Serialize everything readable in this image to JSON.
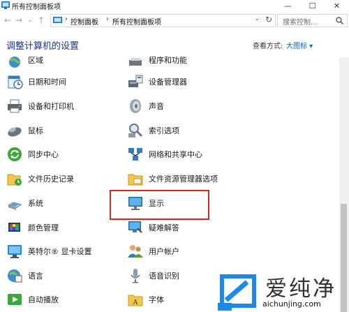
{
  "window": {
    "title": "所有控制面板项",
    "controls": {
      "minimize": "—",
      "maximize": "☐",
      "close": "✕"
    }
  },
  "navbar": {
    "back": "←",
    "forward": "→",
    "history": "⌄",
    "up": "↑",
    "breadcrumb": [
      "控制面板",
      "所有控制面板项"
    ],
    "separator": "›",
    "dropdown": "⌄",
    "refresh": "↻",
    "search_placeholder": "搜索控制..."
  },
  "header": {
    "heading": "调整计算机的设置",
    "view_by_label": "查看方式:",
    "view_by_value": "大图标 ▾"
  },
  "items_left": [
    {
      "id": "region",
      "label": "区域",
      "icon": "region-icon"
    },
    {
      "id": "datetime",
      "label": "日期和时间",
      "icon": "datetime-icon"
    },
    {
      "id": "devices-printers",
      "label": "设备和打印机",
      "icon": "printer-icon"
    },
    {
      "id": "mouse",
      "label": "鼠标",
      "icon": "mouse-icon"
    },
    {
      "id": "sync-center",
      "label": "同步中心",
      "icon": "sync-icon"
    },
    {
      "id": "file-history",
      "label": "文件历史记录",
      "icon": "file-history-icon"
    },
    {
      "id": "system",
      "label": "系统",
      "icon": "system-icon"
    },
    {
      "id": "color-management",
      "label": "颜色管理",
      "icon": "color-management-icon"
    },
    {
      "id": "intel-graphics",
      "label": "英特尔® 显卡设置",
      "icon": "intel-graphics-icon"
    },
    {
      "id": "language",
      "label": "语言",
      "icon": "language-icon"
    },
    {
      "id": "autoplay",
      "label": "自动播放",
      "icon": "autoplay-icon"
    }
  ],
  "items_right": [
    {
      "id": "programs-features",
      "label": "程序和功能",
      "icon": "programs-icon"
    },
    {
      "id": "device-manager",
      "label": "设备管理器",
      "icon": "device-manager-icon"
    },
    {
      "id": "sound",
      "label": "声音",
      "icon": "sound-icon"
    },
    {
      "id": "indexing",
      "label": "索引选项",
      "icon": "indexing-icon"
    },
    {
      "id": "network-sharing",
      "label": "网络和共享中心",
      "icon": "network-icon"
    },
    {
      "id": "file-explorer-options",
      "label": "文件资源管理器选项",
      "icon": "folder-options-icon"
    },
    {
      "id": "display",
      "label": "显示",
      "icon": "display-icon"
    },
    {
      "id": "troubleshooting",
      "label": "疑难解答",
      "icon": "troubleshooting-icon"
    },
    {
      "id": "user-accounts",
      "label": "用户帐户",
      "icon": "user-accounts-icon"
    },
    {
      "id": "speech-recognition",
      "label": "语音识别",
      "icon": "speech-icon"
    },
    {
      "id": "fonts",
      "label": "字体",
      "icon": "fonts-icon"
    }
  ],
  "watermark": {
    "brand": "爱纯净",
    "url": "aichunjing.com"
  },
  "colors": {
    "heading": "#1e3287",
    "link": "#0066cc",
    "highlight": "#d9261f"
  }
}
